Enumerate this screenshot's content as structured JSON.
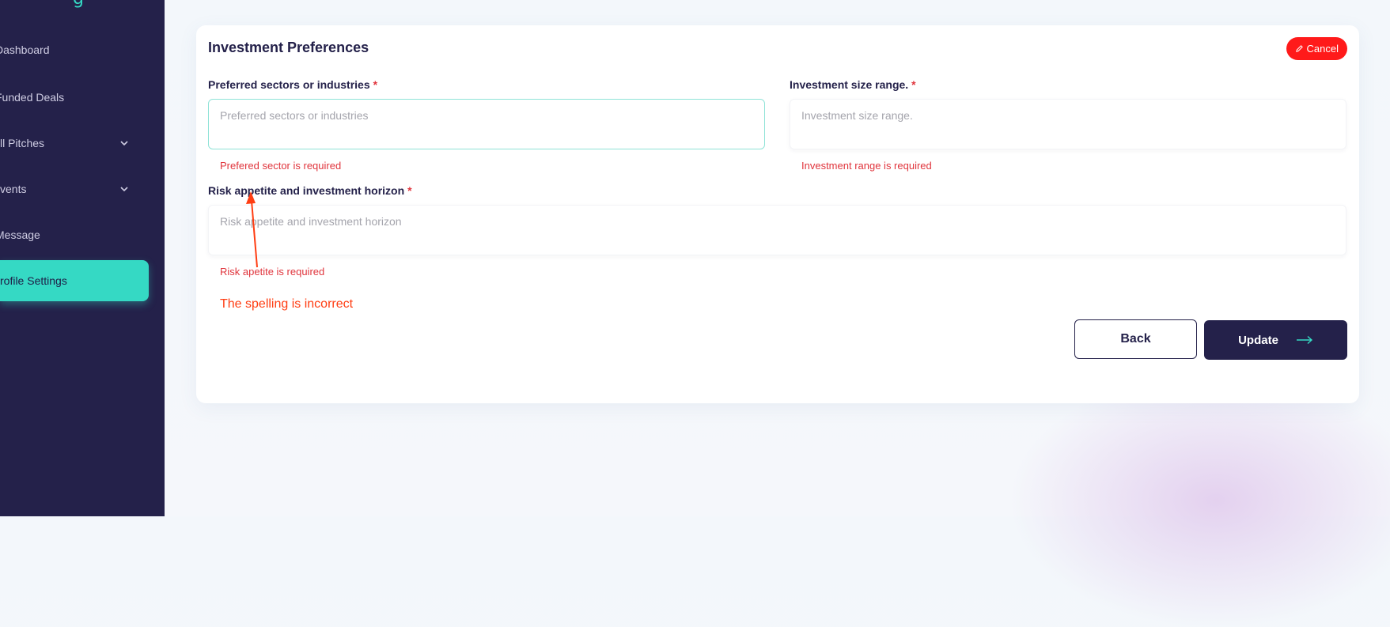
{
  "sidebar": {
    "brand_fragment": "g",
    "items": [
      {
        "label": "Dashboard",
        "has_chevron": false
      },
      {
        "label": "Funded Deals",
        "has_chevron": false
      },
      {
        "label": "All Pitches",
        "has_chevron": true
      },
      {
        "label": "Events",
        "has_chevron": true
      },
      {
        "label": "Message",
        "has_chevron": false
      },
      {
        "label": "Profile Settings",
        "has_chevron": false,
        "active": true
      }
    ],
    "visible_labels": [
      "Dashboard",
      "Funded Deals",
      "ll Pitches",
      "vents",
      "Message",
      "rofile Settings"
    ]
  },
  "form": {
    "title": "Investment Preferences",
    "cancel_label": "Cancel",
    "fields": {
      "sectors": {
        "label": "Preferred sectors or industries",
        "required_mark": "*",
        "placeholder": "Preferred sectors or industries",
        "value": "",
        "error": "Prefered sector is required"
      },
      "size_range": {
        "label": "Investment size range.",
        "required_mark": "*",
        "placeholder": "Investment size range.",
        "value": "",
        "error": "Investment range is required"
      },
      "risk": {
        "label": "Risk appetite and investment horizon",
        "required_mark": "*",
        "placeholder": "Risk appetite and investment horizon",
        "value": "",
        "error": "Risk apetite is required"
      }
    },
    "back_label": "Back",
    "update_label": "Update"
  },
  "annotation": {
    "text": "The spelling is incorrect",
    "color": "#ff3d12"
  },
  "colors": {
    "sidebar_bg": "#24214a",
    "accent": "#35d9c4",
    "error": "#e0343c",
    "cancel_bg": "#ff1a1a",
    "primary_button": "#24214a"
  }
}
